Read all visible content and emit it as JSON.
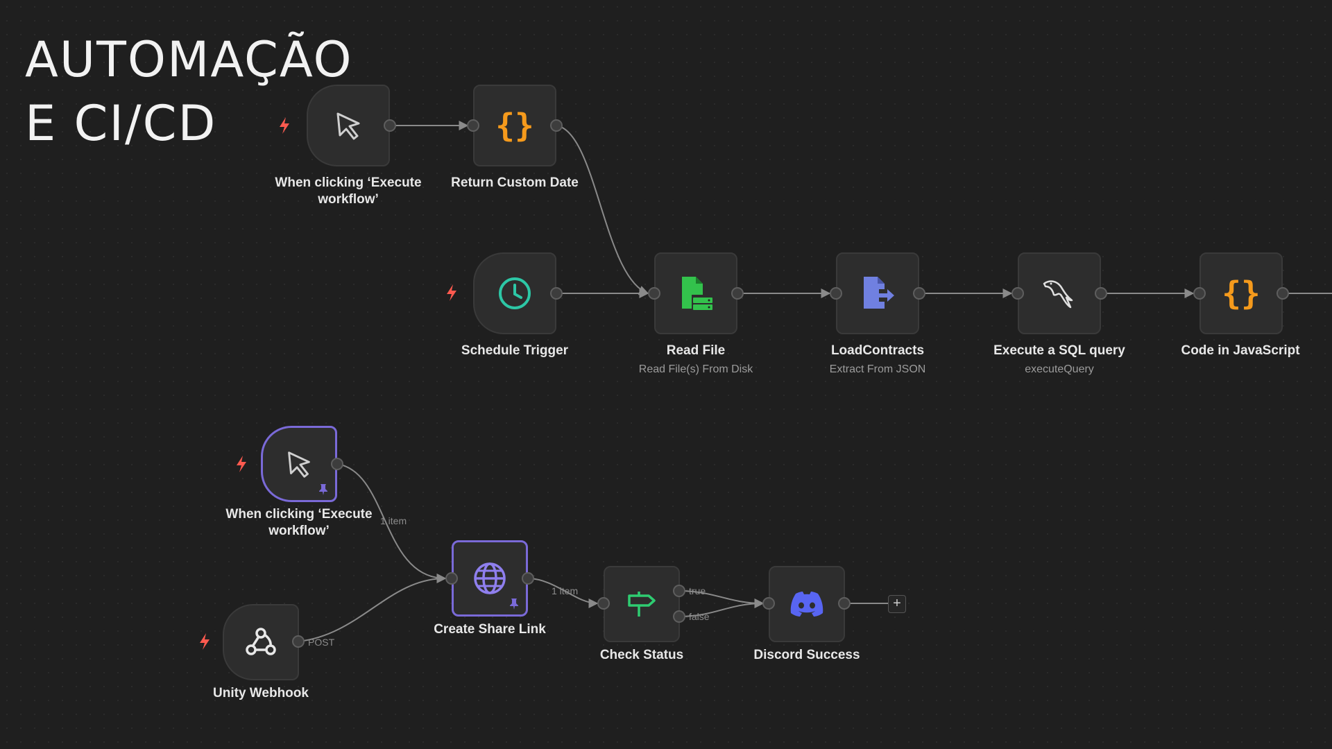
{
  "title": {
    "line1": "AUTOMAÇÃO",
    "line2": "E CI/CD"
  },
  "colors": {
    "canvas_bg": "#1f1f1f",
    "node_bg": "#2d2d2d",
    "connector": "#8a8a8a",
    "trigger_bolt": "#ff5a4f",
    "pinned_border": "#7a6ad8",
    "code_icon": "#f59a1c",
    "schedule_icon": "#2dc7a6",
    "file_icon": "#33c24c",
    "json_icon": "#7080e0",
    "webhook_icon": "#e8e8e8",
    "globe_icon": "#8f7fee",
    "if_icon": "#2ecc71",
    "discord_icon": "#5865f2"
  },
  "nodes": {
    "manual_trigger_1": {
      "label": "When clicking ‘Execute workflow’",
      "icon": "cursor-icon"
    },
    "return_custom_date": {
      "label": "Return Custom Date",
      "icon": "code-braces-icon"
    },
    "schedule_trigger": {
      "label": "Schedule Trigger",
      "icon": "clock-icon"
    },
    "read_file": {
      "label": "Read File",
      "subtitle": "Read File(s) From Disk",
      "icon": "file-disk-icon"
    },
    "load_contracts": {
      "label": "LoadContracts",
      "subtitle": "Extract From JSON",
      "icon": "file-export-icon"
    },
    "sql_query": {
      "label": "Execute a SQL query",
      "subtitle": "executeQuery",
      "icon": "mysql-dolphin-icon"
    },
    "code_js": {
      "label": "Code in JavaScript",
      "icon": "code-braces-icon"
    },
    "manual_trigger_2": {
      "label": "When clicking ‘Execute workflow’",
      "icon": "cursor-icon"
    },
    "create_share_link": {
      "label": "Create Share Link",
      "icon": "globe-icon"
    },
    "check_status": {
      "label": "Check Status",
      "icon": "signpost-icon"
    },
    "discord_success": {
      "label": "Discord Success",
      "icon": "discord-icon"
    },
    "unity_webhook": {
      "label": "Unity Webhook",
      "icon": "webhook-icon"
    }
  },
  "edge_labels": {
    "trigger_to_share": "1 item",
    "share_to_status": "1 item",
    "true_branch": "true",
    "false_branch": "false",
    "webhook_method": "POST"
  },
  "add_button": "+"
}
